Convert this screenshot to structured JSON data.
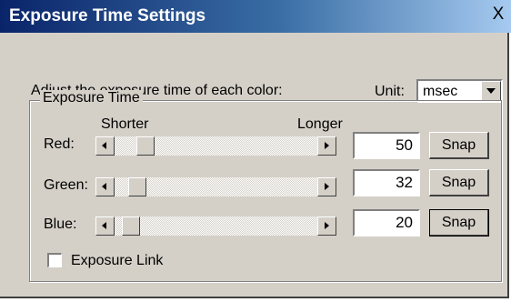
{
  "window": {
    "title": "Exposure Time Settings",
    "close_glyph": "X"
  },
  "prompt": "Adjust the exposure time of each color:",
  "unit": {
    "label": "Unit:",
    "selected": "msec"
  },
  "group": {
    "title": "Exposure Time"
  },
  "slider_hints": {
    "shorter": "Shorter",
    "longer": "Longer"
  },
  "rows": [
    {
      "label": "Red:",
      "value": "50",
      "snap_label": "Snap"
    },
    {
      "label": "Green:",
      "value": "32",
      "snap_label": "Snap"
    },
    {
      "label": "Blue:",
      "value": "20",
      "snap_label": "Snap"
    }
  ],
  "exposure_link": {
    "label": "Exposure Link",
    "checked": false
  }
}
